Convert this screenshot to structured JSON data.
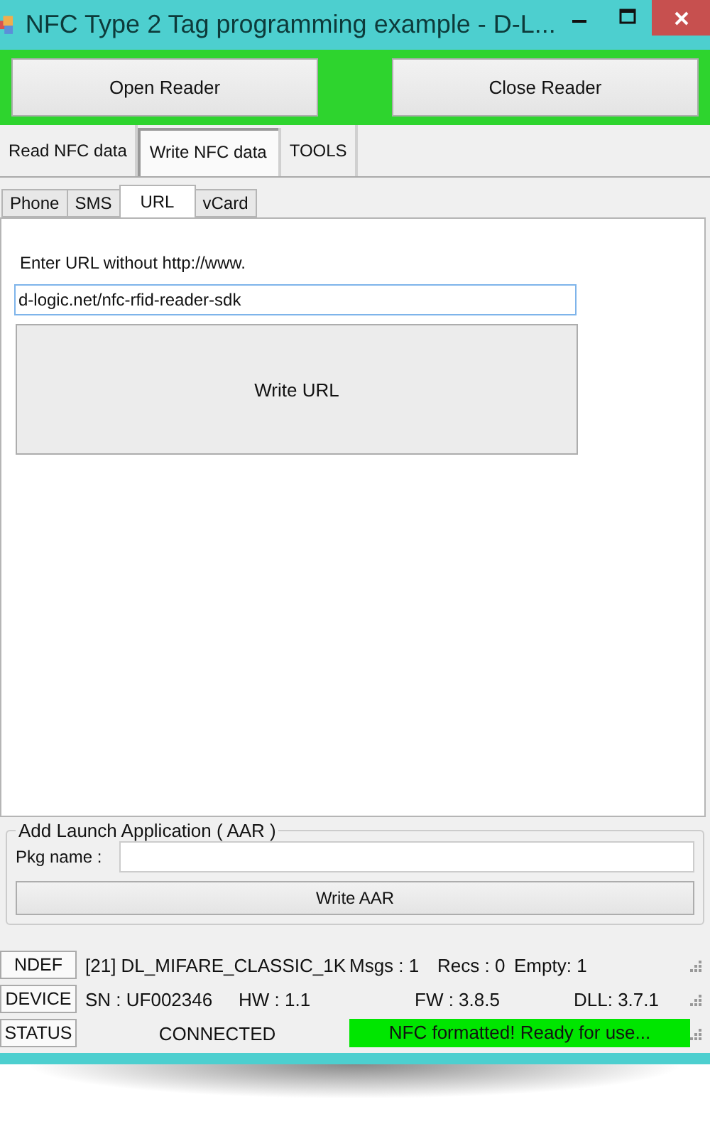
{
  "window": {
    "title": "NFC Type 2 Tag programming example -  D-L..."
  },
  "reader_buttons": [
    "Open Reader",
    "Close Reader"
  ],
  "main_tabs": [
    {
      "label": "Read NFC data",
      "selected": false
    },
    {
      "label": "Write NFC data",
      "selected": true
    },
    {
      "label": "TOOLS",
      "selected": false
    }
  ],
  "sub_tabs": [
    {
      "label": "Phone",
      "selected": false
    },
    {
      "label": "SMS",
      "selected": false
    },
    {
      "label": "URL",
      "selected": true
    },
    {
      "label": "vCard",
      "selected": false
    }
  ],
  "url_panel": {
    "label": "Enter URL without http://www.",
    "value": "d-logic.net/nfc-rfid-reader-sdk",
    "button": "Write URL"
  },
  "aar_group": {
    "title": "Add Launch Application ( AAR )",
    "field_label": "Pkg name :",
    "button": "Write AAR"
  },
  "status_rows": [
    {
      "label": "NDEF",
      "texts": [
        "[21] DL_MIFARE_CLASSIC_1K",
        "Msgs : 1",
        "Recs : 0",
        "Empty: 1"
      ]
    },
    {
      "label": "DEVICE",
      "texts": [
        "SN : UF002346",
        "HW : 1.1",
        "FW : 3.8.5",
        "DLL: 3.7.1"
      ]
    },
    {
      "label": "STATUS",
      "texts": [
        "CONNECTED"
      ],
      "message": "NFC formatted! Ready for use..."
    }
  ]
}
